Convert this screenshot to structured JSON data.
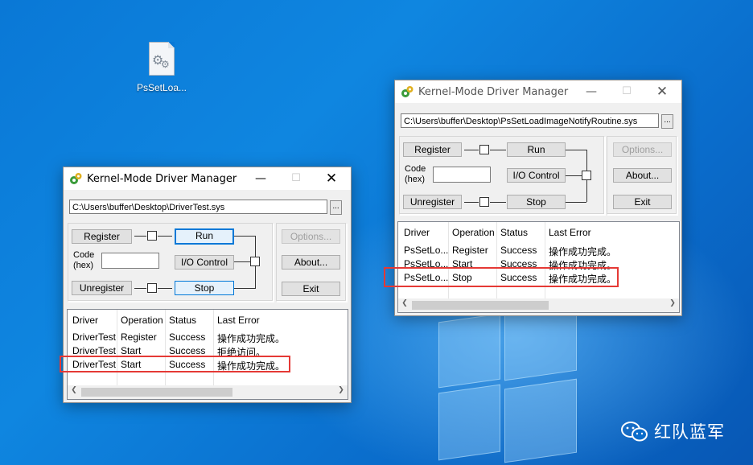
{
  "desktop": {
    "file_icon_label": "PsSetLoa..."
  },
  "window_left": {
    "title": "Kernel-Mode Driver Manager",
    "path": "C:\\Users\\buffer\\Desktop\\DriverTest.sys",
    "browse_label": "...",
    "register_label": "Register",
    "run_label": "Run",
    "code_label_1": "Code",
    "code_label_2": "(hex)",
    "io_control_label": "I/O Control",
    "unregister_label": "Unregister",
    "stop_label": "Stop",
    "options_label": "Options...",
    "about_label": "About...",
    "exit_label": "Exit",
    "columns": [
      "Driver",
      "Operation",
      "Status",
      "Last Error"
    ],
    "rows": [
      [
        "DriverTest",
        "Register",
        "Success",
        "操作成功完成。"
      ],
      [
        "DriverTest",
        "Start",
        "Success",
        "拒绝访问。"
      ],
      [
        "DriverTest",
        "Start",
        "Success",
        "操作成功完成。"
      ]
    ]
  },
  "window_right": {
    "title": "Kernel-Mode Driver Manager",
    "path": "C:\\Users\\buffer\\Desktop\\PsSetLoadImageNotifyRoutine.sys",
    "browse_label": "...",
    "register_label": "Register",
    "run_label": "Run",
    "code_label_1": "Code",
    "code_label_2": "(hex)",
    "io_control_label": "I/O Control",
    "unregister_label": "Unregister",
    "stop_label": "Stop",
    "options_label": "Options...",
    "about_label": "About...",
    "exit_label": "Exit",
    "columns": [
      "Driver",
      "Operation",
      "Status",
      "Last Error"
    ],
    "rows": [
      [
        "PsSetLo...",
        "Register",
        "Success",
        "操作成功完成。"
      ],
      [
        "PsSetLo...",
        "Start",
        "Success",
        "操作成功完成。"
      ],
      [
        "PsSetLo...",
        "Stop",
        "Success",
        "操作成功完成。"
      ]
    ]
  },
  "watermark": {
    "text": "红队蓝军"
  },
  "colors": {
    "desktop_blue": "#0a78d6",
    "highlight_red": "#e53935",
    "focus_blue": "#0078d7"
  }
}
